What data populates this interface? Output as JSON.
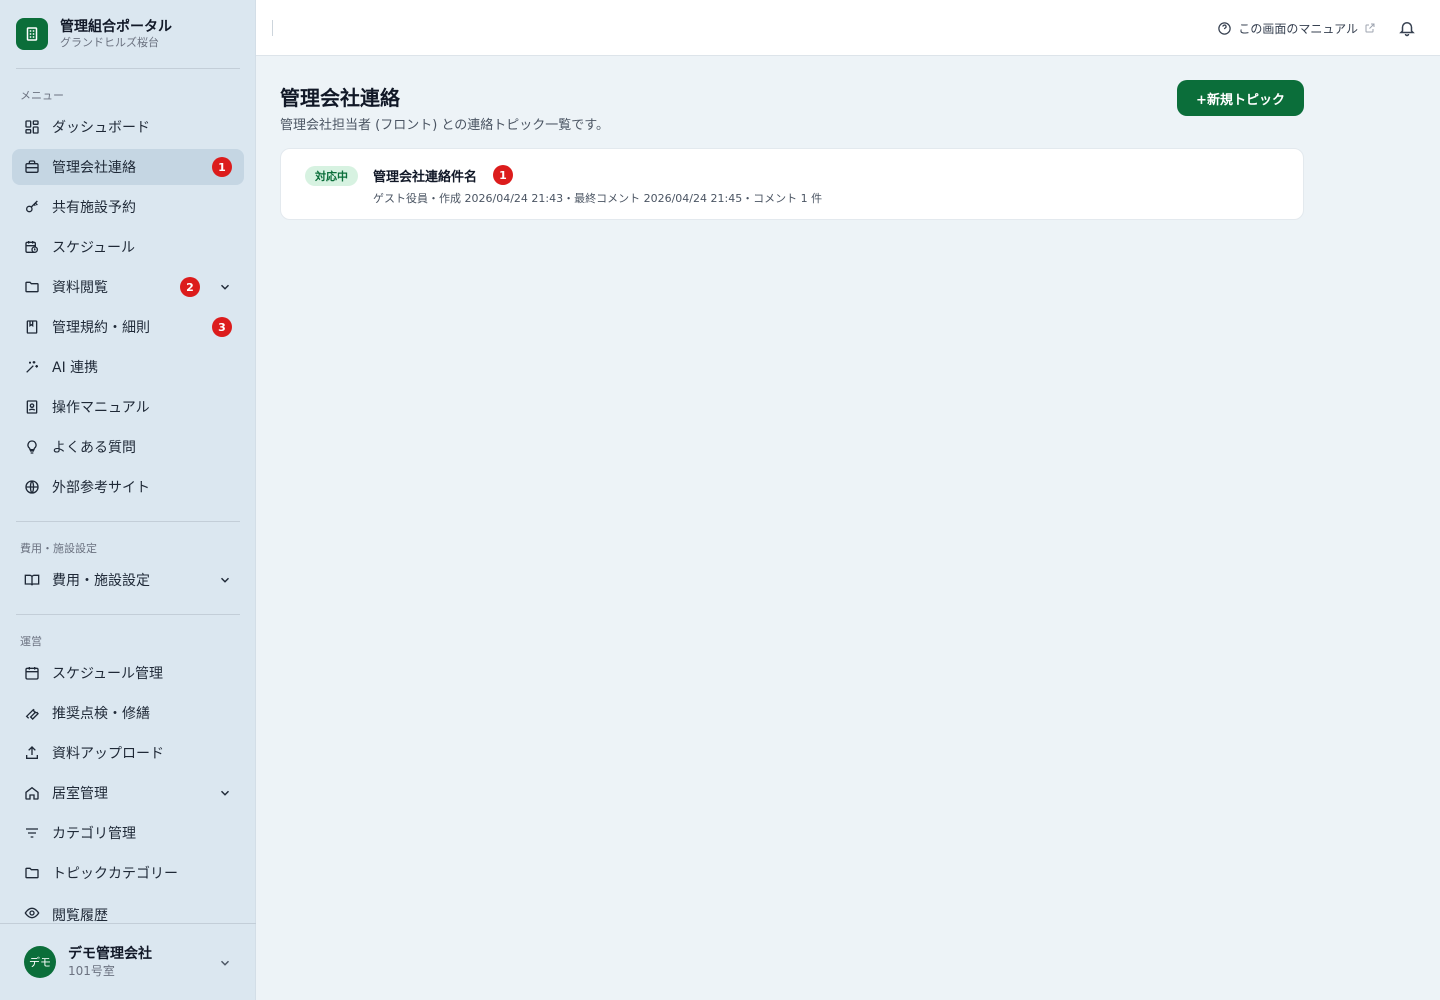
{
  "brand": {
    "title": "管理組合ポータル",
    "subtitle": "グランドヒルズ桜台"
  },
  "sections": {
    "menu": "メニュー",
    "cost": "費用・施設設定",
    "ops": "運営"
  },
  "menu_items": [
    {
      "label": "ダッシュボード",
      "icon": "dashboard-icon"
    },
    {
      "label": "管理会社連絡",
      "icon": "briefcase-icon",
      "badge": "1",
      "active": true
    },
    {
      "label": "共有施設予約",
      "icon": "key-icon"
    },
    {
      "label": "スケジュール",
      "icon": "calendar-clock-icon"
    },
    {
      "label": "資料閲覧",
      "icon": "folder-icon",
      "badge": "2",
      "expandable": true
    },
    {
      "label": "管理規約・細則",
      "icon": "book-icon",
      "badge": "3"
    },
    {
      "label": "AI 連携",
      "icon": "sparkle-icon"
    },
    {
      "label": "操作マニュアル",
      "icon": "manual-icon"
    },
    {
      "label": "よくある質問",
      "icon": "lightbulb-icon"
    },
    {
      "label": "外部参考サイト",
      "icon": "globe-icon"
    }
  ],
  "cost_items": [
    {
      "label": "費用・施設設定",
      "icon": "open-book-icon",
      "expandable": true
    }
  ],
  "ops_items": [
    {
      "label": "スケジュール管理",
      "icon": "calendar-icon"
    },
    {
      "label": "推奨点検・修繕",
      "icon": "wrench-icon"
    },
    {
      "label": "資料アップロード",
      "icon": "upload-icon"
    },
    {
      "label": "居室管理",
      "icon": "home-icon",
      "expandable": true
    },
    {
      "label": "カテゴリ管理",
      "icon": "filter-icon"
    },
    {
      "label": "トピックカテゴリー",
      "icon": "folder-icon"
    },
    {
      "label": "閲覧履歴",
      "icon": "eye-icon"
    }
  ],
  "user": {
    "avatar": "デモ",
    "name": "デモ管理会社",
    "room": "101号室"
  },
  "topbar": {
    "manual_label": "この画面のマニュアル"
  },
  "main": {
    "title": "管理会社連絡",
    "description": "管理会社担当者 (フロント) との連絡トピック一覧です。",
    "new_button": "+新規トピック"
  },
  "topics": [
    {
      "status": "対応中",
      "title": "管理会社連絡件名",
      "badge": "1",
      "meta": "ゲスト役員・作成 2026/04/24 21:43・最終コメント 2026/04/24 21:45・コメント 1 件"
    }
  ],
  "colors": {
    "accent": "#0b6e3a",
    "badge": "#dc1c1c",
    "sidebar": "#dbe7f0",
    "active": "#c5d6e3"
  }
}
